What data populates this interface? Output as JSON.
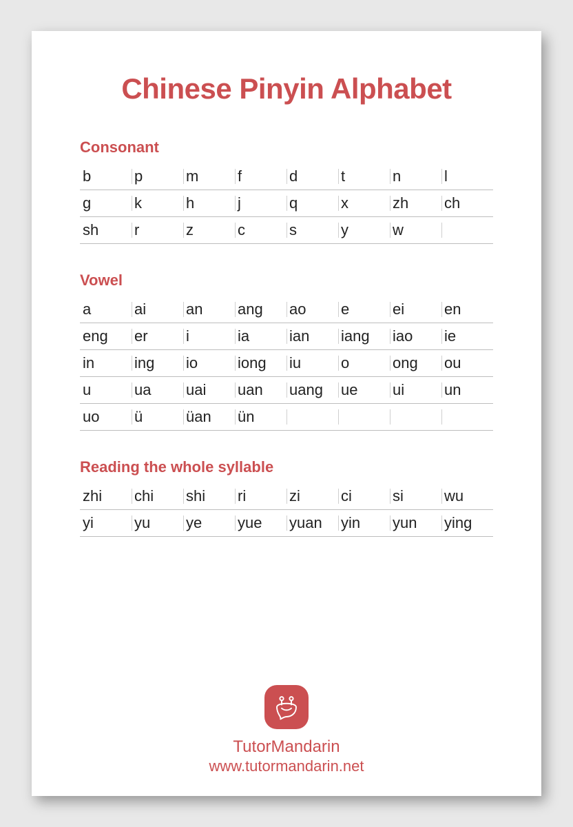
{
  "title": "Chinese Pinyin Alphabet",
  "sections": [
    {
      "heading": "Consonant",
      "rows": [
        [
          "b",
          "p",
          "m",
          "f",
          "d",
          "t",
          "n",
          "l"
        ],
        [
          "g",
          "k",
          "h",
          "j",
          "q",
          "x",
          "zh",
          "ch"
        ],
        [
          "sh",
          "r",
          "z",
          "c",
          "s",
          "y",
          "w",
          ""
        ]
      ]
    },
    {
      "heading": "Vowel",
      "rows": [
        [
          "a",
          "ai",
          "an",
          "ang",
          "ao",
          "e",
          "ei",
          "en"
        ],
        [
          "eng",
          "er",
          "i",
          "ia",
          "ian",
          "iang",
          "iao",
          "ie"
        ],
        [
          "in",
          "ing",
          "io",
          "iong",
          "iu",
          "o",
          "ong",
          "ou"
        ],
        [
          "u",
          "ua",
          "uai",
          "uan",
          "uang",
          "ue",
          "ui",
          "un"
        ],
        [
          "uo",
          "ü",
          "üan",
          "ün",
          "",
          "",
          "",
          ""
        ]
      ]
    },
    {
      "heading": "Reading the whole syllable",
      "rows": [
        [
          "zhi",
          "chi",
          "shi",
          "ri",
          "zi",
          "ci",
          "si",
          "wu"
        ],
        [
          "yi",
          "yu",
          "ye",
          "yue",
          "yuan",
          "yin",
          "yun",
          "ying"
        ]
      ]
    }
  ],
  "footer": {
    "brand": "TutorMandarin",
    "url": "www.tutormandarin.net"
  },
  "colors": {
    "accent": "#cb4f51"
  }
}
